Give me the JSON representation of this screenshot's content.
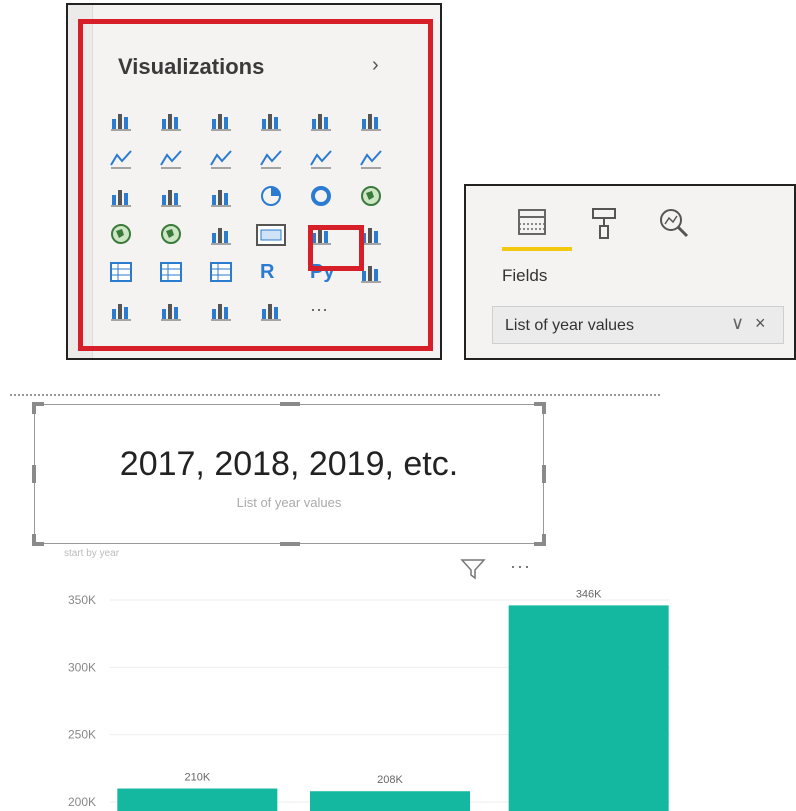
{
  "viz_pane": {
    "title": "Visualizations",
    "chevron": "›",
    "icons": [
      "stacked-bar-icon",
      "stacked-column-icon",
      "clustered-bar-icon",
      "clustered-column-icon",
      "100-stacked-bar-icon",
      "100-stacked-column-icon",
      "line-chart-icon",
      "area-chart-icon",
      "stacked-area-icon",
      "line-clustered-column-icon",
      "line-stacked-column-icon",
      "ribbon-chart-icon",
      "waterfall-icon",
      "funnel-icon",
      "scatter-icon",
      "pie-icon",
      "donut-icon",
      "treemap-icon",
      "map-icon",
      "filled-map-icon",
      "gauge-icon",
      "card-icon",
      "multi-row-card-icon",
      "kpi-icon",
      "slicer-icon",
      "table-icon",
      "matrix-icon",
      "r-visual-icon",
      "python-visual-icon",
      "key-influencers-icon",
      "decomposition-tree-icon",
      "qa-icon",
      "smart-narrative-icon",
      "paginated-icon",
      "more-icon"
    ],
    "r_label": "R",
    "py_label": "Py",
    "more_label": "···"
  },
  "fields_pane": {
    "tab_fields_label": "Fields",
    "field_chip": "List of year values",
    "chip_chevron": "∨",
    "chip_close": "×"
  },
  "card": {
    "value": "2017, 2018, 2019, etc.",
    "label": "List of year values"
  },
  "chart_caption": "start by year",
  "chart_more": "···",
  "colors": {
    "highlight": "#d71f2a",
    "bar": "#14b8a0",
    "accent": "#f2c811",
    "icon_blue": "#2b7bd1"
  },
  "chart_data": {
    "type": "bar",
    "categories": [
      "",
      "",
      ""
    ],
    "values": [
      210,
      208,
      346
    ],
    "data_labels": [
      "210K",
      "208K",
      "346K"
    ],
    "y_ticks": [
      200,
      250,
      300,
      350
    ],
    "y_tick_labels": [
      "200K",
      "250K",
      "300K",
      "350K"
    ],
    "ylim": [
      200,
      350
    ],
    "grid": true,
    "title": "",
    "xlabel": "",
    "ylabel": ""
  }
}
